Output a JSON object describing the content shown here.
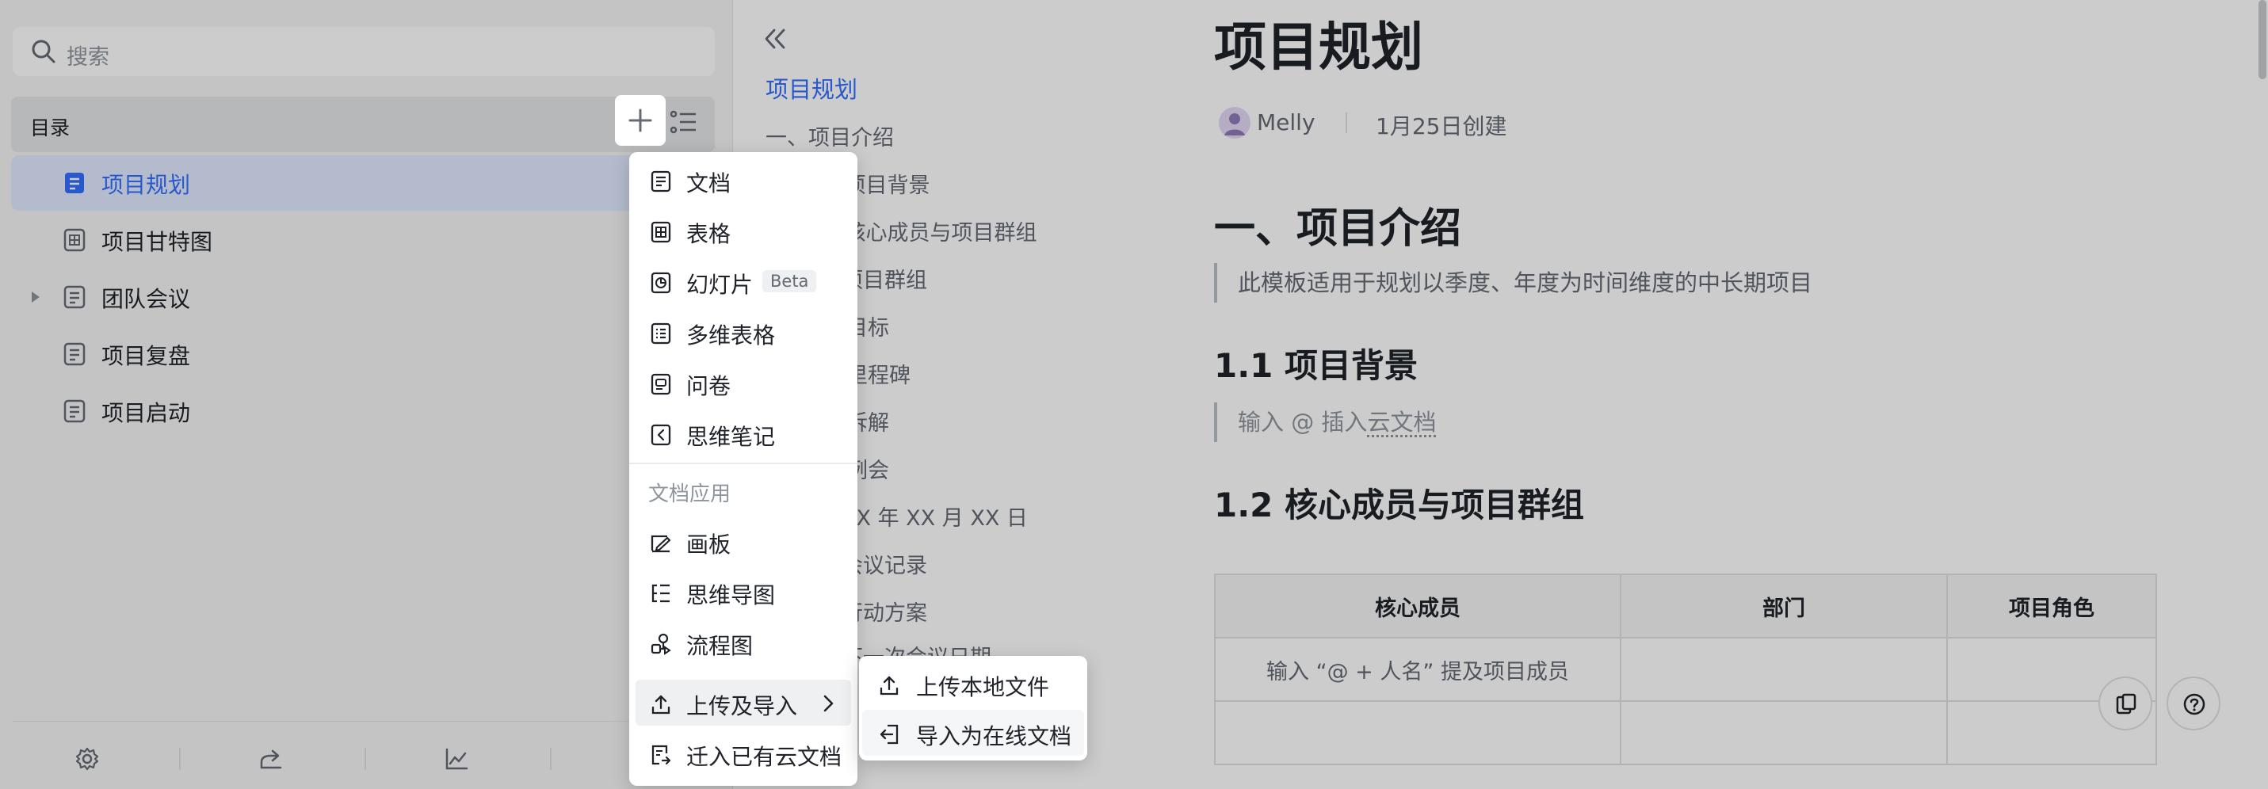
{
  "sidebar": {
    "search_placeholder": "搜索",
    "directory_label": "目录",
    "items": [
      {
        "label": "项目规划",
        "icon": "doc-icon",
        "active": true
      },
      {
        "label": "项目甘特图",
        "icon": "table-icon"
      },
      {
        "label": "团队会议",
        "icon": "doc-icon",
        "has_children": true
      },
      {
        "label": "项目复盘",
        "icon": "doc-icon"
      },
      {
        "label": "项目启动",
        "icon": "doc-icon"
      }
    ]
  },
  "outline": {
    "items": [
      "项目规划",
      "一、项目介绍",
      "1.1 项目背景",
      "1.2 核心成员与项目群组",
      "项目群组",
      "项目目标",
      "项目里程碑",
      "任务拆解",
      "项目例会",
      "XX 年 XX 月 XX 日",
      "会议记录",
      "行动方案",
      "下一次会议日期"
    ]
  },
  "doc": {
    "title": "项目规划",
    "author": "Melly",
    "created": "1月25日创建",
    "h1": "一、项目介绍",
    "intro_quote": "此模板适用于规划以季度、年度为时间维度的中长期项目",
    "h2_background": "1.1 项目背景",
    "placeholder_prefix": "输入 @ 插入",
    "placeholder_link": "云文档",
    "h2_members": "1.2 核心成员与项目群组",
    "table": {
      "headers": [
        "核心成员",
        "部门",
        "项目角色"
      ],
      "rows": [
        [
          "输入 “@ + 人名” 提及项目成员",
          "",
          ""
        ],
        [
          "",
          "",
          ""
        ]
      ]
    }
  },
  "new_menu": {
    "items": [
      {
        "label": "文档",
        "icon": "doc-icon"
      },
      {
        "label": "表格",
        "icon": "table-icon"
      },
      {
        "label": "幻灯片",
        "icon": "slides-icon",
        "badge": "Beta"
      },
      {
        "label": "多维表格",
        "icon": "bitable-icon"
      },
      {
        "label": "问卷",
        "icon": "survey-icon"
      },
      {
        "label": "思维笔记",
        "icon": "mindnote-icon"
      }
    ],
    "group_label": "文档应用",
    "app_items": [
      {
        "label": "画板",
        "icon": "whiteboard-icon"
      },
      {
        "label": "思维导图",
        "icon": "mindmap-icon"
      },
      {
        "label": "流程图",
        "icon": "flowchart-icon"
      }
    ],
    "upload": {
      "label": "上传及导入",
      "icon": "upload-icon"
    },
    "migrate": {
      "label": "迁入已有云文档",
      "icon": "migrate-icon"
    }
  },
  "upload_submenu": {
    "items": [
      {
        "label": "上传本地文件",
        "icon": "upload-icon"
      },
      {
        "label": "导入为在线文档",
        "icon": "import-icon"
      }
    ]
  },
  "colors": {
    "accent": "#3370ff",
    "active_bg": "#e1eaff",
    "text_primary": "#1f2329",
    "text_secondary": "#646a73"
  }
}
